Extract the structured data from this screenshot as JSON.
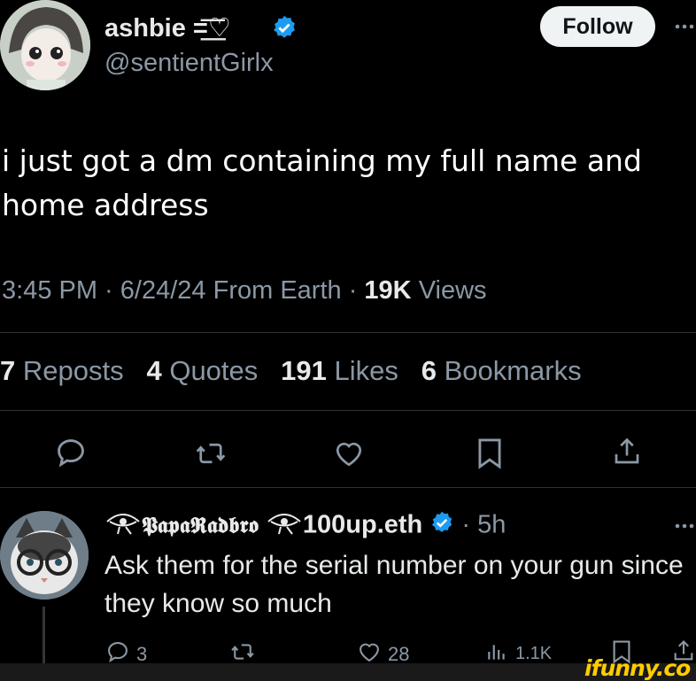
{
  "tweet": {
    "display_name": "ashbie =͟͟͞͞♡",
    "handle": "@sentientGirlx",
    "follow_label": "Follow",
    "text": "i just got a dm containing my full name and home address",
    "time": "3:45 PM",
    "date": "6/24/24",
    "source": "From Earth",
    "views_count": "19K",
    "views_label": "Views",
    "stats": {
      "reposts_count": "7",
      "reposts_label": "Reposts",
      "quotes_count": "4",
      "quotes_label": "Quotes",
      "likes_count": "191",
      "likes_label": "Likes",
      "bookmarks_count": "6",
      "bookmarks_label": "Bookmarks"
    },
    "icons": [
      "reply-icon",
      "repost-icon",
      "like-icon",
      "bookmark-icon",
      "share-icon"
    ]
  },
  "reply": {
    "display_name": "𝕻𝖆𝖕𝖆𝕽𝖆𝖉𝖇𝖗𝖔",
    "display_name_suffix": "100up.eth",
    "age": "5h",
    "text": "Ask them for the serial number on your gun since they know so much",
    "replies": "3",
    "likes": "28",
    "views": "1.1K"
  },
  "watermark": "ifunny.co",
  "colors": {
    "verified": "#1d9bf0",
    "background": "#000000",
    "muted": "#8b98a5",
    "watermark": "#ffcc00"
  }
}
